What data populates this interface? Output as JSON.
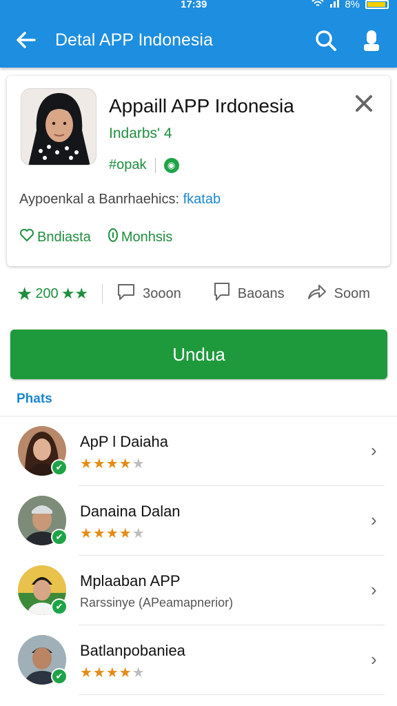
{
  "status_bar": {
    "time": "17:39",
    "battery": "8%"
  },
  "app_bar": {
    "title": "Detal APP Indonesia",
    "back_icon": "back-arrow-icon",
    "search_icon": "search-icon",
    "account_icon": "user-icon",
    "color": "#1d8ee0"
  },
  "app_card": {
    "name": "Appaill APP Irdonesia",
    "developer": "Indarbs' 4",
    "tag": "#opak",
    "description_prefix": "Aypoenkal a Banrhaehics: ",
    "description_link": "fkatab",
    "chips": [
      {
        "icon": "heart-icon",
        "label": "Bndiasta"
      },
      {
        "icon": "info-icon",
        "label": "Monhsis"
      }
    ]
  },
  "stats": {
    "rating_text": "200",
    "rating_stars": "★★",
    "items": [
      {
        "icon": "comment-icon",
        "label": "3ooon"
      },
      {
        "icon": "bookmark-icon",
        "label": "Baoans"
      },
      {
        "icon": "share-icon",
        "label": "Soom"
      }
    ]
  },
  "install_button": {
    "label": "Undua",
    "color": "#1e9a3c"
  },
  "section": {
    "title": "Phats"
  },
  "list": [
    {
      "name": "ApP l Daiaha",
      "stars": 4,
      "subtitle": ""
    },
    {
      "name": "Danaina Dalan",
      "stars": 4,
      "subtitle": ""
    },
    {
      "name": "Mplaaban APP",
      "stars": 0,
      "subtitle": "Rarssinye (APeamapnerior)"
    },
    {
      "name": "Batlanpobaniea",
      "stars": 4,
      "subtitle": ""
    }
  ]
}
